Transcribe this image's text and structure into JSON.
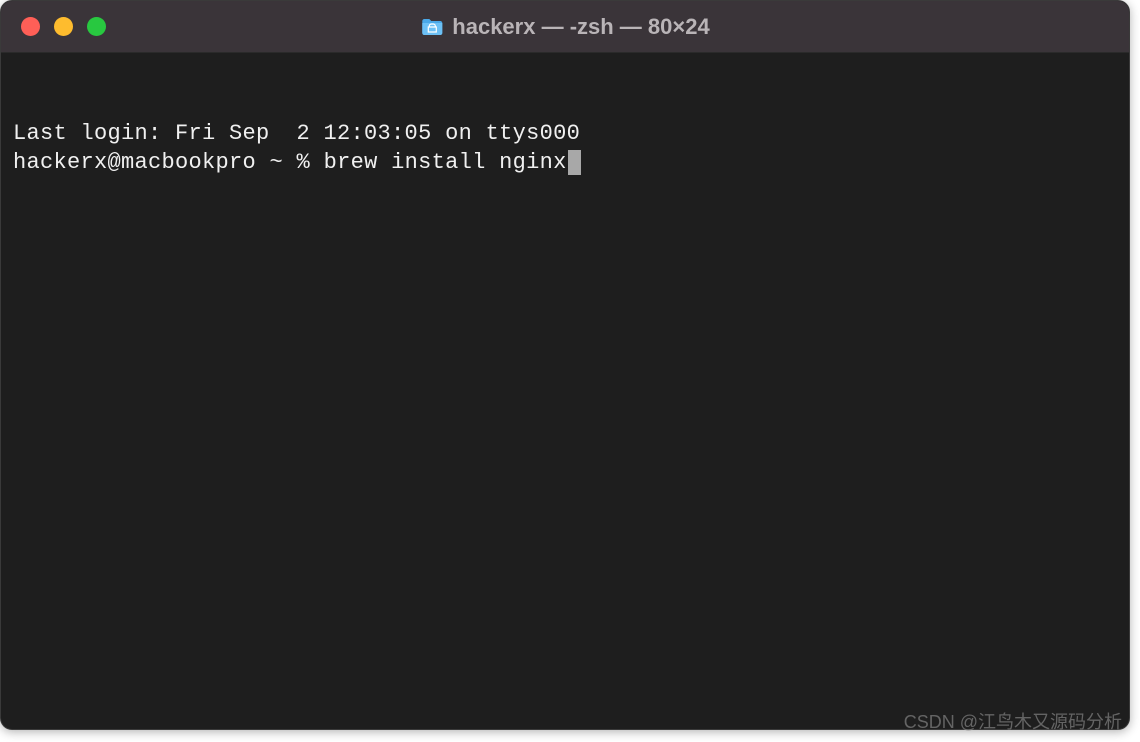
{
  "titlebar": {
    "title": "hackerx — -zsh — 80×24",
    "icon_color": "#4aa8e8"
  },
  "terminal": {
    "line1": "Last login: Fri Sep  2 12:03:05 on ttys000",
    "prompt": "hackerx@macbookpro ~ % ",
    "command": "brew install nginx"
  },
  "watermark": "CSDN @江鸟木又源码分析"
}
